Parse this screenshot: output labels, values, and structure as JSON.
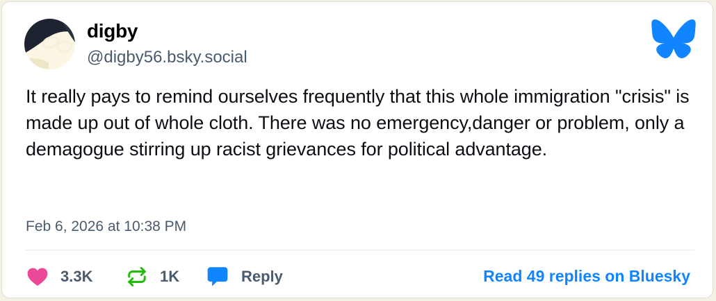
{
  "post": {
    "author": {
      "display_name": "digby",
      "handle": "@digby56.bsky.social"
    },
    "text": "It really pays to remind ourselves frequently that this whole immigration \"crisis\" is made up out of whole cloth. There was no emergency,danger or problem, only a demagogue stirring up racist grievances for political advantage.",
    "timestamp": "Feb 6, 2026 at 10:38 PM"
  },
  "actions": {
    "likes": "3.3K",
    "reposts": "1K",
    "reply_label": "Reply",
    "read_replies_label": "Read 49 replies on Bluesky"
  },
  "icons": {
    "logo": "bluesky-butterfly-icon",
    "like": "heart-icon",
    "repost": "repost-icon",
    "reply": "speech-bubble-icon"
  },
  "colors": {
    "brand_blue": "#1185fe",
    "like_pink": "#ec4899",
    "repost_green": "#20bc07",
    "muted_text": "#4b5b6e"
  }
}
